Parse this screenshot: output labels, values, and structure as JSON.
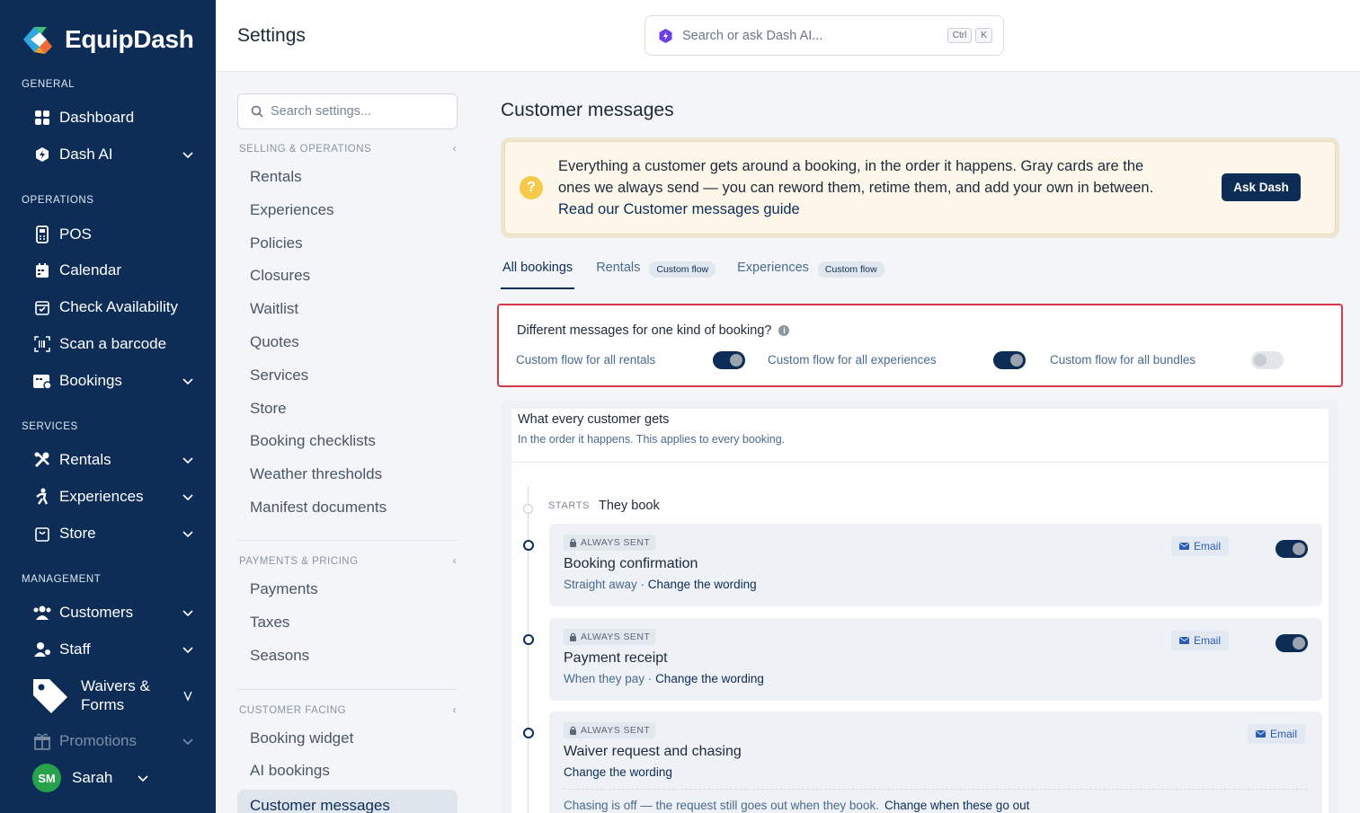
{
  "app": {
    "name": "EquipDash"
  },
  "sidebar": {
    "sections": {
      "general": "GENERAL",
      "operations": "OPERATIONS",
      "services": "SERVICES",
      "management": "MANAGEMENT"
    },
    "items": {
      "dashboard": "Dashboard",
      "dash_ai": "Dash AI",
      "pos": "POS",
      "calendar": "Calendar",
      "check_availability": "Check Availability",
      "scan_barcode": "Scan a barcode",
      "bookings": "Bookings",
      "rentals": "Rentals",
      "experiences": "Experiences",
      "store": "Store",
      "customers": "Customers",
      "staff": "Staff",
      "waivers_line1": "Waivers &",
      "waivers_line2": "Forms",
      "promotions": "Promotions"
    },
    "user": {
      "initials": "SM",
      "name": "Sarah"
    }
  },
  "header": {
    "title": "Settings",
    "search_placeholder": "Search or ask Dash AI...",
    "kbd_ctrl": "Ctrl",
    "kbd_k": "K"
  },
  "settings_nav": {
    "search_placeholder": "Search settings...",
    "groups": {
      "selling": "SELLING & OPERATIONS",
      "payments": "PAYMENTS & PRICING",
      "customer": "CUSTOMER FACING"
    },
    "collapse_glyph": "‹",
    "selling_items": [
      "Rentals",
      "Experiences",
      "Policies",
      "Closures",
      "Waitlist",
      "Quotes",
      "Services",
      "Store",
      "Booking checklists",
      "Weather thresholds",
      "Manifest documents"
    ],
    "payments_items": [
      "Payments",
      "Taxes",
      "Seasons"
    ],
    "customer_items": [
      "Booking widget",
      "AI bookings"
    ],
    "active_item": "Customer messages"
  },
  "main": {
    "title": "Customer messages",
    "banner": {
      "icon": "?",
      "line1": "Everything a customer gets around a booking, in the order it happens. Gray cards are the",
      "line2": "ones we always send — you can reword them, retime them, and add your own in between.",
      "link": "Read our Customer messages guide",
      "button": "Ask Dash"
    },
    "tabs": {
      "all": "All bookings",
      "rentals": "Rentals",
      "experiences": "Experiences",
      "custom_tag": "Custom flow"
    },
    "flow": {
      "question": "Different messages for one kind of booking?",
      "info": "i",
      "rentals": "Custom flow for all rentals",
      "experiences": "Custom flow for all experiences",
      "bundles": "Custom flow for all bundles",
      "rentals_on": true,
      "experiences_on": true,
      "bundles_on": false
    },
    "list": {
      "title": "What every customer gets",
      "subtitle": "In the order it happens. This applies to every booking.",
      "starts_label": "STARTS",
      "starts_value": "They book",
      "always_sent": "ALWAYS SENT",
      "email": "Email",
      "change_wording": "Change the wording",
      "messages": [
        {
          "title": "Booking confirmation",
          "timing": "Straight away · "
        },
        {
          "title": "Payment receipt",
          "timing": "When they pay · "
        },
        {
          "title": "Waiver request and chasing",
          "timing": ""
        }
      ],
      "chasing_note": "Chasing is off — the request still goes out when they book.",
      "chasing_link": "Change when these go out"
    }
  }
}
